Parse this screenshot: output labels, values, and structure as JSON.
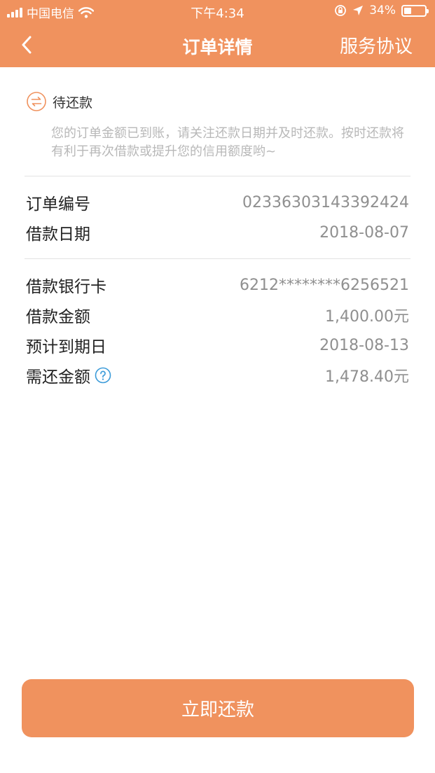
{
  "statusbar": {
    "carrier": "中国电信",
    "time": "下午4:34",
    "battery": "34%",
    "battery_level": 0.34
  },
  "nav": {
    "title": "订单详情",
    "right": "服务协议"
  },
  "order_status": {
    "label": "待还款",
    "description": "您的订单金额已到账，请关注还款日期并及时还款。按时还款将有利于再次借款或提升您的信用额度哟~"
  },
  "order": [
    {
      "label": "订单编号",
      "value": "02336303143392424"
    },
    {
      "label": "借款日期",
      "value": "2018-08-07"
    }
  ],
  "loan": [
    {
      "label": "借款银行卡",
      "value": "6212********6256521"
    },
    {
      "label": "借款金额",
      "value": "1,400.00元"
    },
    {
      "label": "预计到期日",
      "value": "2018-08-13"
    },
    {
      "label": "需还金额",
      "value": "1,478.40元"
    }
  ],
  "actions": {
    "pay_now": "立即还款"
  },
  "colors": {
    "accent": "#F0925E",
    "help": "#3B9BD9"
  }
}
